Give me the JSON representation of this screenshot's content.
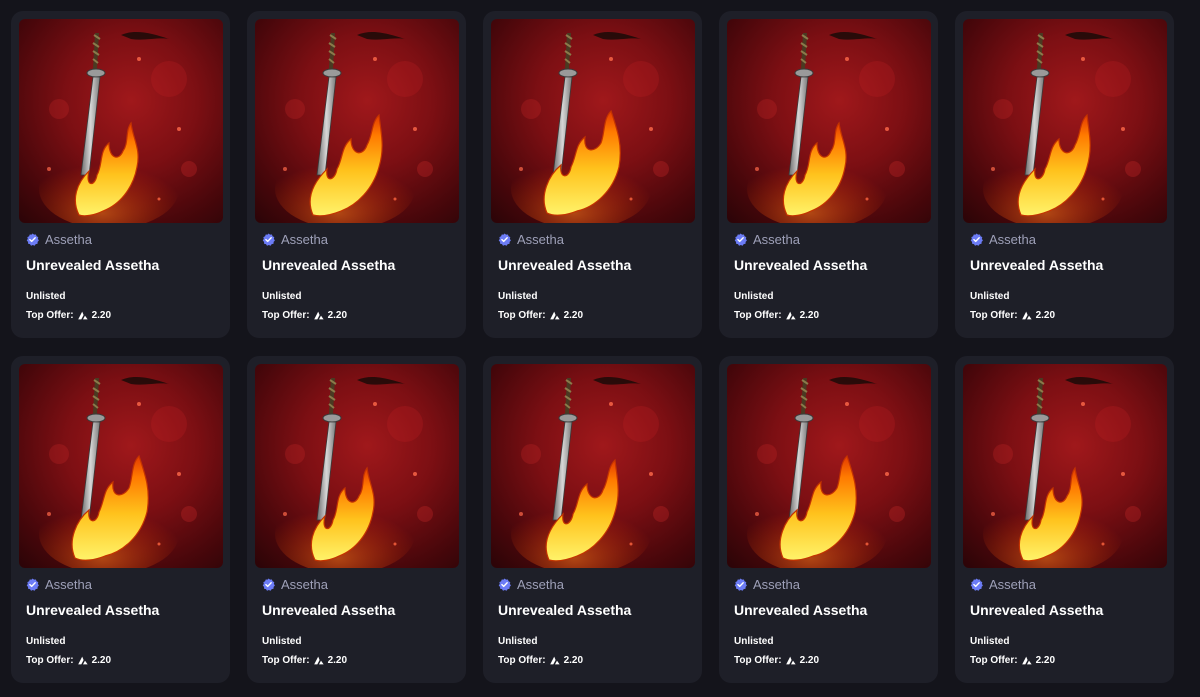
{
  "colors": {
    "background": "#14141b",
    "card": "#1e1f28",
    "verified": "#6c7cf5",
    "art_red": "#a0181b"
  },
  "cards": [
    {
      "creator": "Assetha",
      "title": "Unrevealed Assetha",
      "status": "Unlisted",
      "offer_label": "Top Offer:",
      "offer_value": "2.20",
      "currency_icon": "avax-icon",
      "verified_icon": "verified-badge-icon"
    },
    {
      "creator": "Assetha",
      "title": "Unrevealed Assetha",
      "status": "Unlisted",
      "offer_label": "Top Offer:",
      "offer_value": "2.20",
      "currency_icon": "avax-icon",
      "verified_icon": "verified-badge-icon"
    },
    {
      "creator": "Assetha",
      "title": "Unrevealed Assetha",
      "status": "Unlisted",
      "offer_label": "Top Offer:",
      "offer_value": "2.20",
      "currency_icon": "avax-icon",
      "verified_icon": "verified-badge-icon"
    },
    {
      "creator": "Assetha",
      "title": "Unrevealed Assetha",
      "status": "Unlisted",
      "offer_label": "Top Offer:",
      "offer_value": "2.20",
      "currency_icon": "avax-icon",
      "verified_icon": "verified-badge-icon"
    },
    {
      "creator": "Assetha",
      "title": "Unrevealed Assetha",
      "status": "Unlisted",
      "offer_label": "Top Offer:",
      "offer_value": "2.20",
      "currency_icon": "avax-icon",
      "verified_icon": "verified-badge-icon"
    },
    {
      "creator": "Assetha",
      "title": "Unrevealed Assetha",
      "status": "Unlisted",
      "offer_label": "Top Offer:",
      "offer_value": "2.20",
      "currency_icon": "avax-icon",
      "verified_icon": "verified-badge-icon"
    },
    {
      "creator": "Assetha",
      "title": "Unrevealed Assetha",
      "status": "Unlisted",
      "offer_label": "Top Offer:",
      "offer_value": "2.20",
      "currency_icon": "avax-icon",
      "verified_icon": "verified-badge-icon"
    },
    {
      "creator": "Assetha",
      "title": "Unrevealed Assetha",
      "status": "Unlisted",
      "offer_label": "Top Offer:",
      "offer_value": "2.20",
      "currency_icon": "avax-icon",
      "verified_icon": "verified-badge-icon"
    },
    {
      "creator": "Assetha",
      "title": "Unrevealed Assetha",
      "status": "Unlisted",
      "offer_label": "Top Offer:",
      "offer_value": "2.20",
      "currency_icon": "avax-icon",
      "verified_icon": "verified-badge-icon"
    },
    {
      "creator": "Assetha",
      "title": "Unrevealed Assetha",
      "status": "Unlisted",
      "offer_label": "Top Offer:",
      "offer_value": "2.20",
      "currency_icon": "avax-icon",
      "verified_icon": "verified-badge-icon"
    }
  ]
}
